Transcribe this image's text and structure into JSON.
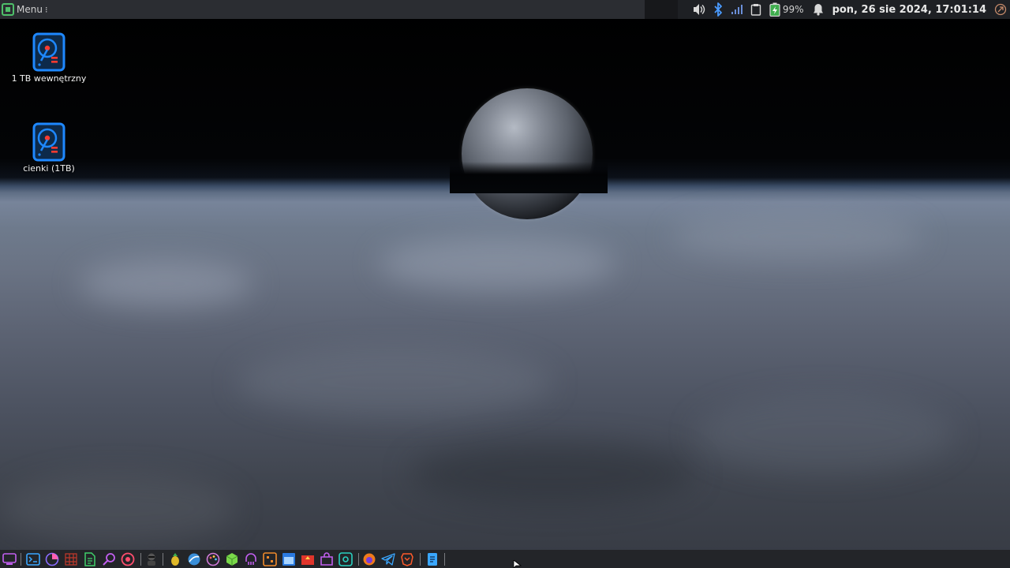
{
  "top_panel": {
    "menu_label": "Menu",
    "menu_dots": "⁝",
    "battery_percent": "99%",
    "clock": "pon, 26 sie 2024, 17:01:14"
  },
  "desktop": {
    "icons": [
      {
        "label": "1 TB wewnętrzny",
        "icon": "hard-drive-icon"
      },
      {
        "label": "cienki (1TB)",
        "icon": "hard-drive-icon"
      }
    ]
  },
  "dock": {
    "items": [
      "show-desktop-icon",
      "terminal-icon",
      "disk-usage-icon",
      "grid-app-icon",
      "text-editor-icon",
      "search-icon",
      "record-icon",
      "hacker-icon",
      "pineapple-icon",
      "browser-icon",
      "palette-icon",
      "cube-icon",
      "octopus-icon",
      "tools-icon",
      "window-manager-icon",
      "presentation-icon",
      "store-icon",
      "screenshot-icon",
      "firefox-icon",
      "telegram-icon",
      "brave-icon",
      "files-icon"
    ]
  },
  "colors": {
    "panel_bg": "#1e2024",
    "accent_green": "#4fc06a",
    "drive_blue": "#1e88ff",
    "drive_red": "#ff3b2f"
  }
}
